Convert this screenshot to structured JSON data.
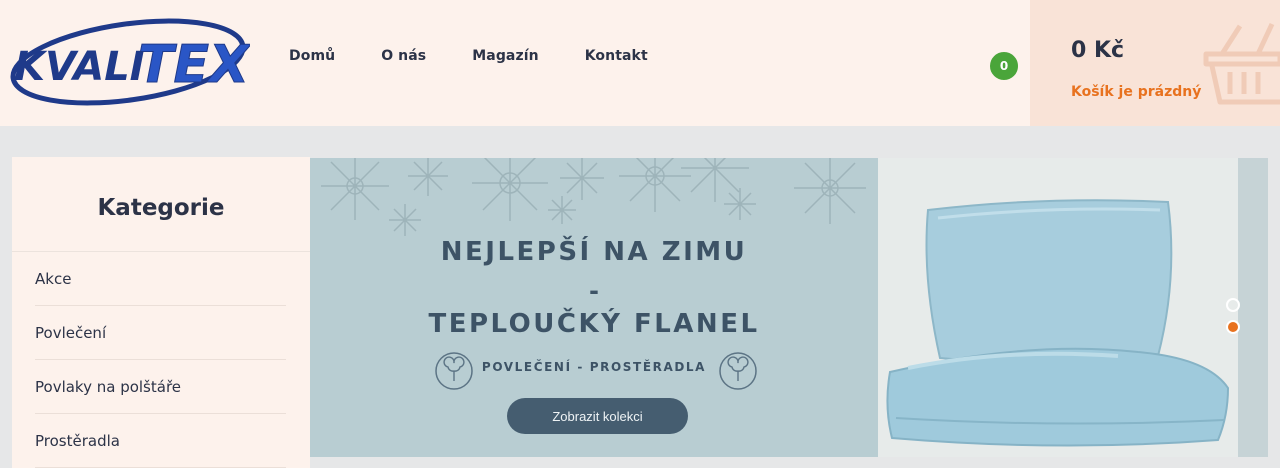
{
  "logo": {
    "text": "KVALITEX",
    "color_primary": "#1f3a8a"
  },
  "nav": {
    "items": [
      {
        "label": "Domů"
      },
      {
        "label": "O nás"
      },
      {
        "label": "Magazín"
      },
      {
        "label": "Kontakt"
      }
    ]
  },
  "cart": {
    "count": "0",
    "total": "0 Kč",
    "status": "Košík je prázdný",
    "badge_color": "#4aa53a"
  },
  "sidebar": {
    "title": "Kategorie",
    "items": [
      {
        "label": "Akce"
      },
      {
        "label": "Povlečení"
      },
      {
        "label": "Povlaky na polštáře"
      },
      {
        "label": "Prostěradla"
      }
    ]
  },
  "banner": {
    "headline": "NEJLEPŠÍ NA ZIMU",
    "dash": "-",
    "subheadline": "TEPLOUČKÝ  FLANEL",
    "tagline": "POVLEČENÍ - PROSTĚRADLA",
    "button_label": "Zobrazit kolekci"
  },
  "slider": {
    "slide_count": 2,
    "active_index": 1,
    "accent_color": "#e8721f"
  }
}
